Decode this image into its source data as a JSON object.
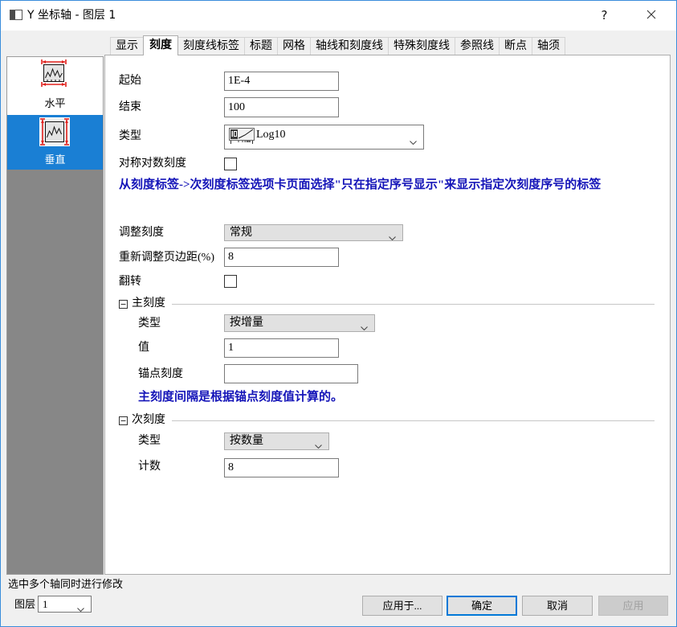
{
  "window": {
    "title": "Y 坐标轴 - 图层 1",
    "help_label": "?"
  },
  "tabs": [
    {
      "label": "显示"
    },
    {
      "label": "刻度",
      "selected": true
    },
    {
      "label": "刻度线标签"
    },
    {
      "label": "标题"
    },
    {
      "label": "网格"
    },
    {
      "label": "轴线和刻度线"
    },
    {
      "label": "特殊刻度线"
    },
    {
      "label": "参照线"
    },
    {
      "label": "断点"
    },
    {
      "label": "轴须"
    }
  ],
  "sidebar": {
    "items": [
      {
        "label": "水平",
        "icon": "horizontal-axis-icon",
        "selected": false
      },
      {
        "label": "垂直",
        "icon": "vertical-axis-icon",
        "selected": true
      }
    ]
  },
  "scale": {
    "from": {
      "label": "起始",
      "value": "1E-4"
    },
    "to": {
      "label": "结束",
      "value": "100"
    },
    "type": {
      "label": "类型",
      "value": "Log10",
      "icon": "log10-scale-icon"
    },
    "symmetric_log": {
      "label": "对称对数刻度",
      "checked": false
    },
    "hint": "从刻度标签->次刻度标签选项卡页面选择\"只在指定序号显示\"来显示指定次刻度序号的标签",
    "rescale": {
      "label": "调整刻度",
      "value": "常规"
    },
    "rescale_margin": {
      "label": "重新调整页边距(%)",
      "value": "8"
    },
    "reverse": {
      "label": "翻转",
      "checked": false
    }
  },
  "major_ticks": {
    "title": "主刻度",
    "expanded": true,
    "type": {
      "label": "类型",
      "value": "按增量"
    },
    "value": {
      "label": "值",
      "value": "1"
    },
    "anchor": {
      "label": "锚点刻度",
      "value": ""
    },
    "hint": "主刻度间隔是根据锚点刻度值计算的。"
  },
  "minor_ticks": {
    "title": "次刻度",
    "expanded": true,
    "type": {
      "label": "类型",
      "value": "按数量"
    },
    "count": {
      "label": "计数",
      "value": "8"
    }
  },
  "footer": {
    "multi_axis_hint": "选中多个轴同时进行修改",
    "layer": {
      "label": "图层",
      "value": "1"
    },
    "buttons": {
      "apply_to": "应用于...",
      "ok": "确定",
      "cancel": "取消",
      "apply": "应用"
    },
    "apply_enabled": false
  },
  "colors": {
    "window_border": "#3a8ddb",
    "dialog_bg": "#f0f0f0",
    "selected_item_bg": "#1a7fd4",
    "sidebar_empty_bg": "#878787",
    "hint_text": "#1414b8",
    "default_button_border": "#0078d7"
  }
}
